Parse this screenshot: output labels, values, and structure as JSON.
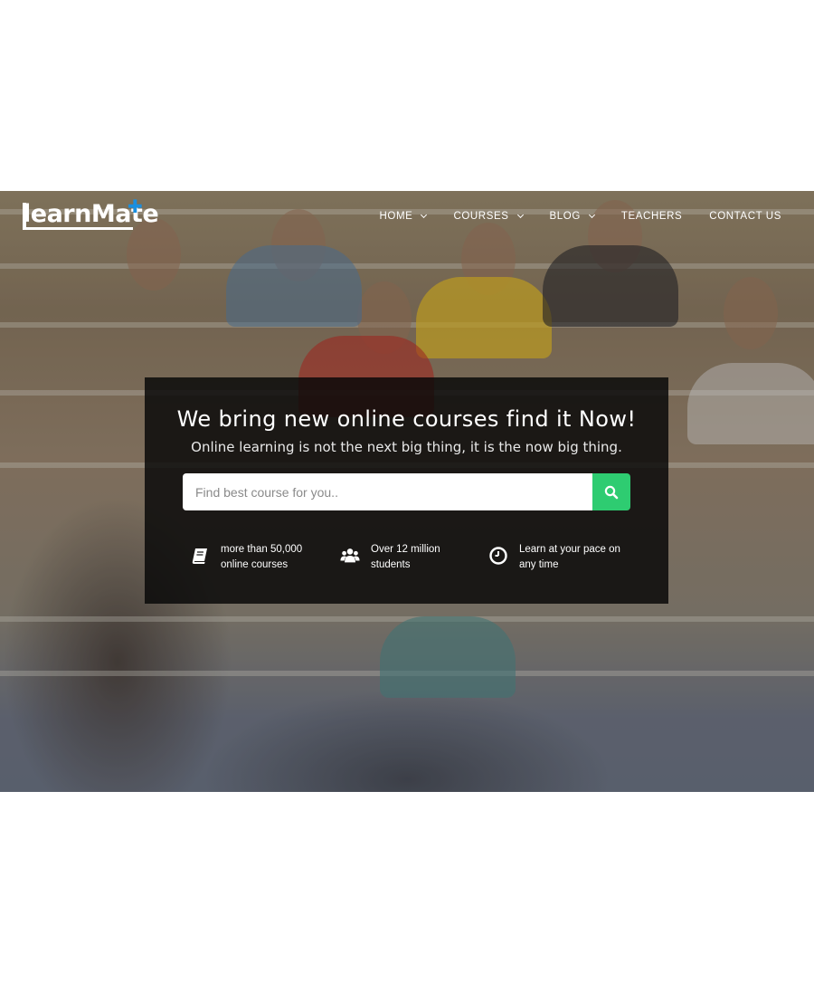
{
  "header": {
    "logo_text": "learnMate",
    "nav": [
      {
        "label": "HOME",
        "has_dropdown": true
      },
      {
        "label": "COURSES",
        "has_dropdown": true
      },
      {
        "label": "BLOG",
        "has_dropdown": true
      },
      {
        "label": "TEACHERS",
        "has_dropdown": false
      },
      {
        "label": "CONTACT US",
        "has_dropdown": false
      }
    ]
  },
  "hero": {
    "title": "We bring new online courses find it Now!",
    "subtitle": "Online learning is not the next big thing, it is the now big thing.",
    "search": {
      "placeholder": "Find best course for you..",
      "value": "",
      "button_icon": "search-icon"
    },
    "features": [
      {
        "icon": "book-icon",
        "text": "more than 50,000\nonline courses"
      },
      {
        "icon": "users-icon",
        "text": "Over 12 million\nstudents"
      },
      {
        "icon": "clock-icon",
        "text": "Learn at your pace on\nany time"
      }
    ]
  },
  "colors": {
    "accent": "#2ecc71",
    "logo_plus": "#1a8fe0",
    "panel_bg": "#080808"
  }
}
